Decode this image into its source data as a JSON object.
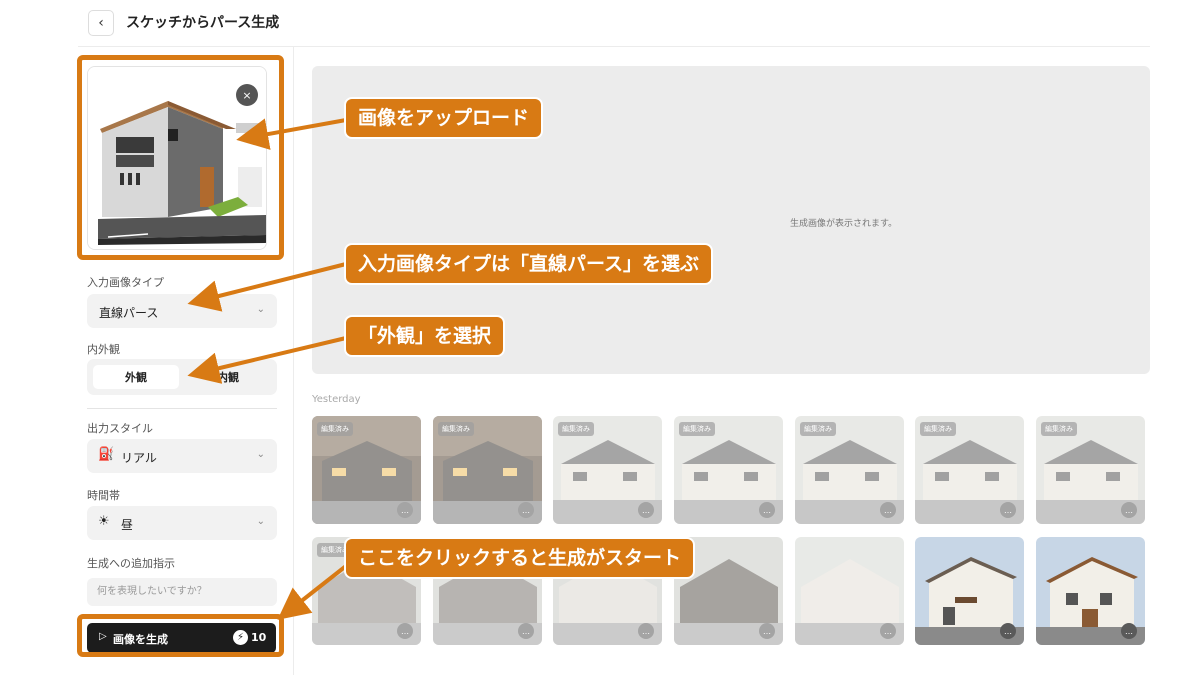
{
  "header": {
    "back_icon": "‹",
    "title": "スケッチからパース生成"
  },
  "upload": {
    "close_icon": "×"
  },
  "input_type": {
    "label": "入力画像タイプ",
    "value": "直線パース"
  },
  "view": {
    "label": "内外観",
    "options": [
      "外観",
      "内観"
    ],
    "selected": "外観"
  },
  "style": {
    "label": "出力スタイル",
    "icon": "paint-bucket-icon",
    "value": "リアル"
  },
  "time": {
    "label": "時間帯",
    "icon": "sun-icon",
    "value": "昼"
  },
  "extra": {
    "label": "生成への追加指示",
    "placeholder": "何を表現したいですか？"
  },
  "generate": {
    "label": "画像を生成",
    "credits": "10"
  },
  "preview": {
    "message": "生成画像が表示されます。"
  },
  "history": {
    "section": "Yesterday",
    "badge": "編集済み",
    "more_icon": "…"
  },
  "callouts": {
    "upload": "画像をアップロード",
    "type": "入力画像タイプは「直線パース」を選ぶ",
    "view": "「外観」を選択",
    "generate": "ここをクリックすると生成がスタート"
  },
  "colors": {
    "accent": "#d87a14",
    "button": "#1c1c1c",
    "panel": "#f2f2f2"
  }
}
